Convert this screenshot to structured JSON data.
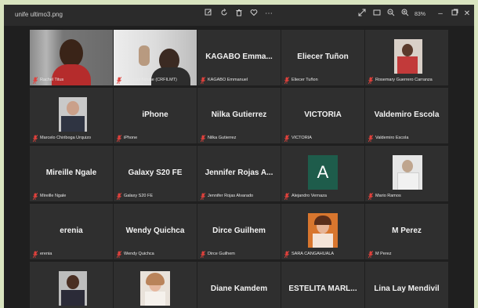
{
  "window": {
    "title": "unife ultimo3.png",
    "zoom": "83%"
  },
  "participants": [
    {
      "label": "Rachel Titus",
      "big": ""
    },
    {
      "label": "Narcisse Nzune (CRFILMT)",
      "big": ""
    },
    {
      "label": "KAGABO Emmanuel",
      "big": "KAGABO Emma..."
    },
    {
      "label": "Eliecer Tuñon",
      "big": "Eliecer Tuñon"
    },
    {
      "label": "Rosemary Guerrero Carranza",
      "big": ""
    },
    {
      "label": "Marcelo Chiriboga Urquizo",
      "big": ""
    },
    {
      "label": "iPhone",
      "big": "iPhone"
    },
    {
      "label": "Nilka Gutierrez",
      "big": "Nilka Gutierrez"
    },
    {
      "label": "VICTORIA",
      "big": "VICTORIA"
    },
    {
      "label": "Valdemiro Escola",
      "big": "Valdemiro Escola"
    },
    {
      "label": "Mireille Ngale",
      "big": "Mireille Ngale"
    },
    {
      "label": "Galaxy S20 FE",
      "big": "Galaxy S20 FE"
    },
    {
      "label": "Jennifer Rojas Alvarado",
      "big": "Jennifer Rojas A..."
    },
    {
      "label": "Alejandro Vernaza",
      "big": "",
      "avatar_letter": "A"
    },
    {
      "label": "Mario Ramos",
      "big": ""
    },
    {
      "label": "erenia",
      "big": "erenia"
    },
    {
      "label": "Wendy Quichca",
      "big": "Wendy Quichca"
    },
    {
      "label": "Dirce Guilhem",
      "big": "Dirce Guilhem"
    },
    {
      "label": "SARA CANGAHUALA",
      "big": ""
    },
    {
      "label": "M Perez",
      "big": "M Perez"
    },
    {
      "label": "",
      "big": ""
    },
    {
      "label": "",
      "big": ""
    },
    {
      "label": "",
      "big": "Diane Kamdem"
    },
    {
      "label": "",
      "big": "ESTELITA MARL..."
    },
    {
      "label": "",
      "big": "Lina Lay Mendivil"
    }
  ],
  "colors": {
    "mic_muted": "#e0413c",
    "tile_bg": "#2f2f2f",
    "avatar_green": "#1e5c4b"
  }
}
